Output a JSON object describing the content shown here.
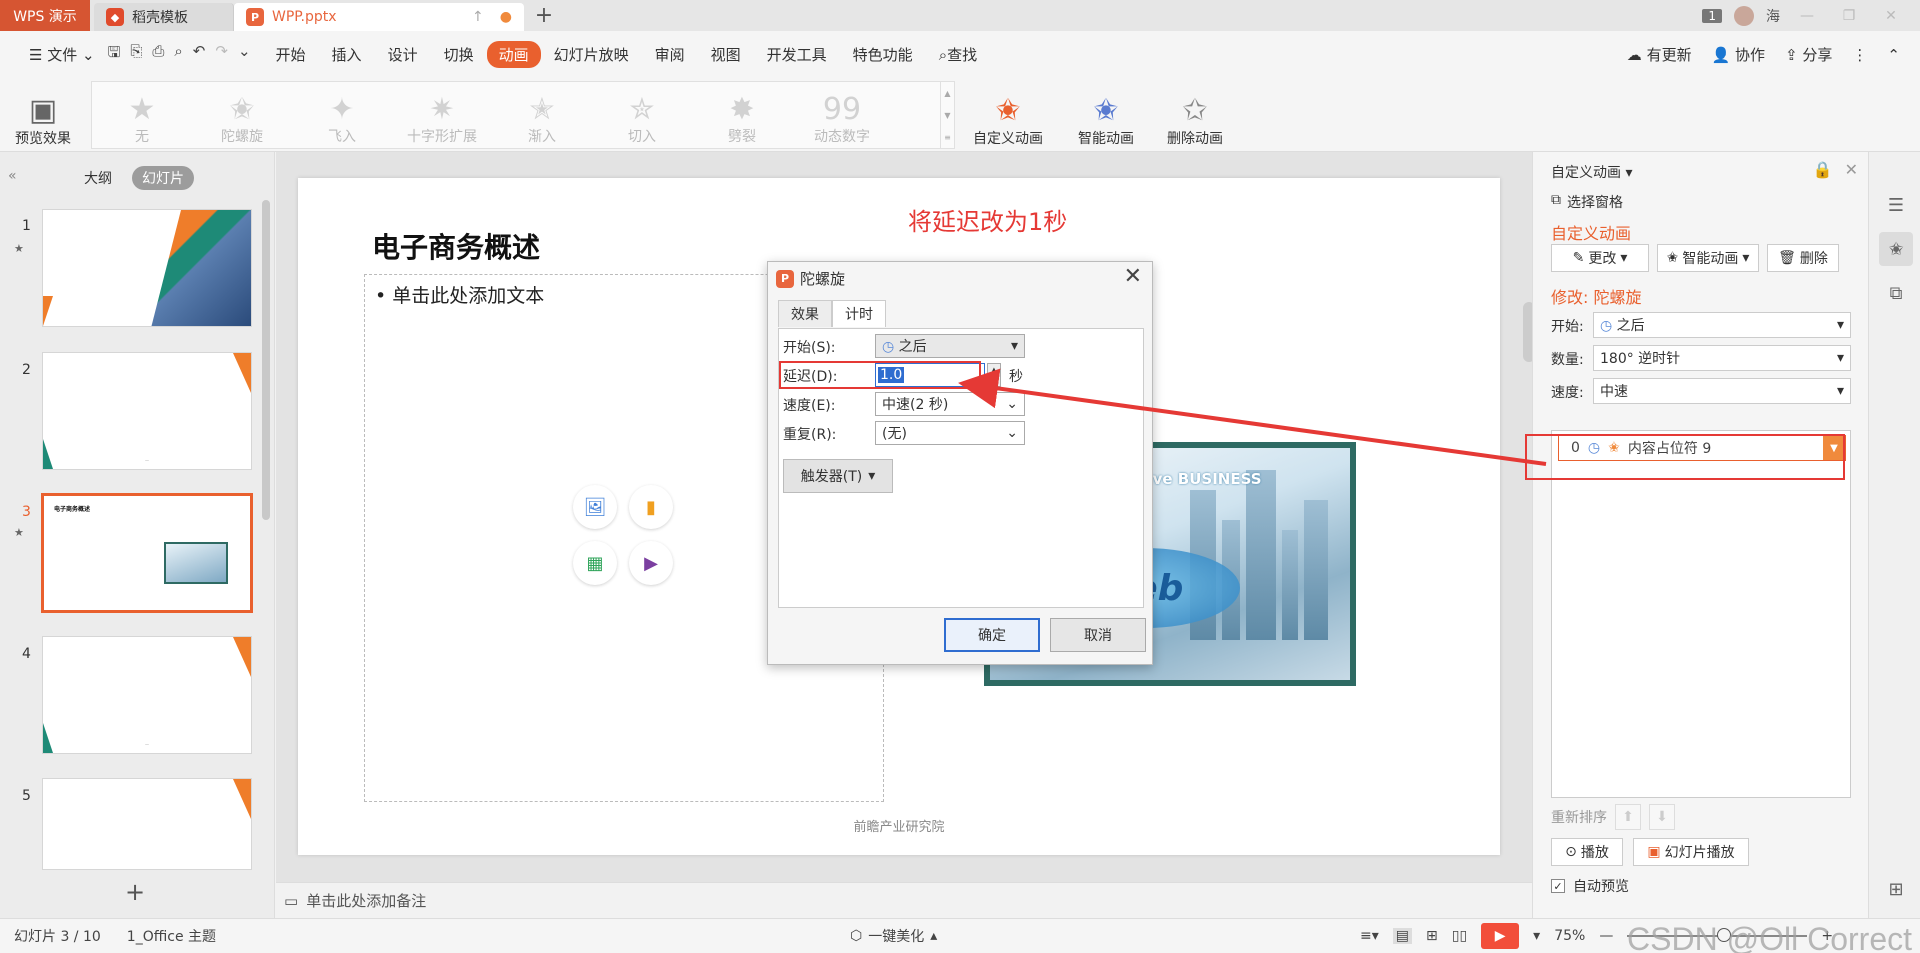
{
  "titlebar": {
    "app_name": "WPS 演示",
    "tabs": [
      {
        "label": "稻壳模板"
      },
      {
        "label": "WPP.pptx"
      }
    ],
    "page_badge": "1",
    "user_name": "海"
  },
  "menu": {
    "file": "文件",
    "items": [
      "开始",
      "插入",
      "设计",
      "切换",
      "动画",
      "幻灯片放映",
      "审阅",
      "视图",
      "开发工具",
      "特色功能"
    ],
    "active": "动画",
    "search": "查找",
    "right": [
      "有更新",
      "协作",
      "分享"
    ]
  },
  "ribbon": {
    "preview": "预览效果",
    "gallery": [
      "无",
      "陀螺旋",
      "飞入",
      "十字形扩展",
      "渐入",
      "切入",
      "劈裂",
      "动态数字"
    ],
    "custom_anim": "自定义动画",
    "smart_anim": "智能动画",
    "delete_anim": "删除动画"
  },
  "left_panel": {
    "tab_outline": "大纲",
    "tab_slides": "幻灯片",
    "slide_numbers": [
      "1",
      "2",
      "3",
      "4",
      "5"
    ],
    "thumb3_title": "电子商务概述"
  },
  "slide": {
    "title": "电子商务概述",
    "placeholder_text": "• 单击此处添加文本",
    "annotation": "将延迟改为1秒",
    "image_text": "eative BUSINESS",
    "image_word": "web",
    "footer": "前瞻产业研究院"
  },
  "notes": {
    "placeholder": "单击此处添加备注"
  },
  "statusbar": {
    "slide_pos": "幻灯片 3 / 10",
    "theme": "1_Office 主题",
    "beautify": "一键美化",
    "zoom": "75%",
    "watermark": "CSDN @Oll Correct"
  },
  "dialog": {
    "title": "陀螺旋",
    "tabs": [
      "效果",
      "计时"
    ],
    "active_tab": "计时",
    "start_label": "开始(S):",
    "start_value": "之后",
    "delay_label": "延迟(D):",
    "delay_value": "1.0",
    "delay_unit": "秒",
    "speed_label": "速度(E):",
    "speed_value": "中速(2 秒)",
    "repeat_label": "重复(R):",
    "repeat_value": "(无)",
    "trigger": "触发器(T)",
    "ok": "确定",
    "cancel": "取消"
  },
  "right_panel": {
    "header": "自定义动画",
    "select_pane": "选择窗格",
    "section_title": "自定义动画",
    "change_btn": "更改",
    "smart_btn": "智能动画",
    "delete_btn": "删除",
    "modify_title": "修改: 陀螺旋",
    "start_label": "开始:",
    "start_value": "之后",
    "amount_label": "数量:",
    "amount_value": "180° 逆时针",
    "speed_label": "速度:",
    "speed_value": "中速",
    "anim_item_index": "0",
    "anim_item_label": "内容占位符 9",
    "reorder": "重新排序",
    "play": "播放",
    "slideshow": "幻灯片播放",
    "auto_preview": "自动预览"
  },
  "colors": {
    "accent": "#e9602e",
    "annotation_red": "#e53935",
    "dialog_focus": "#2f6dd0"
  }
}
